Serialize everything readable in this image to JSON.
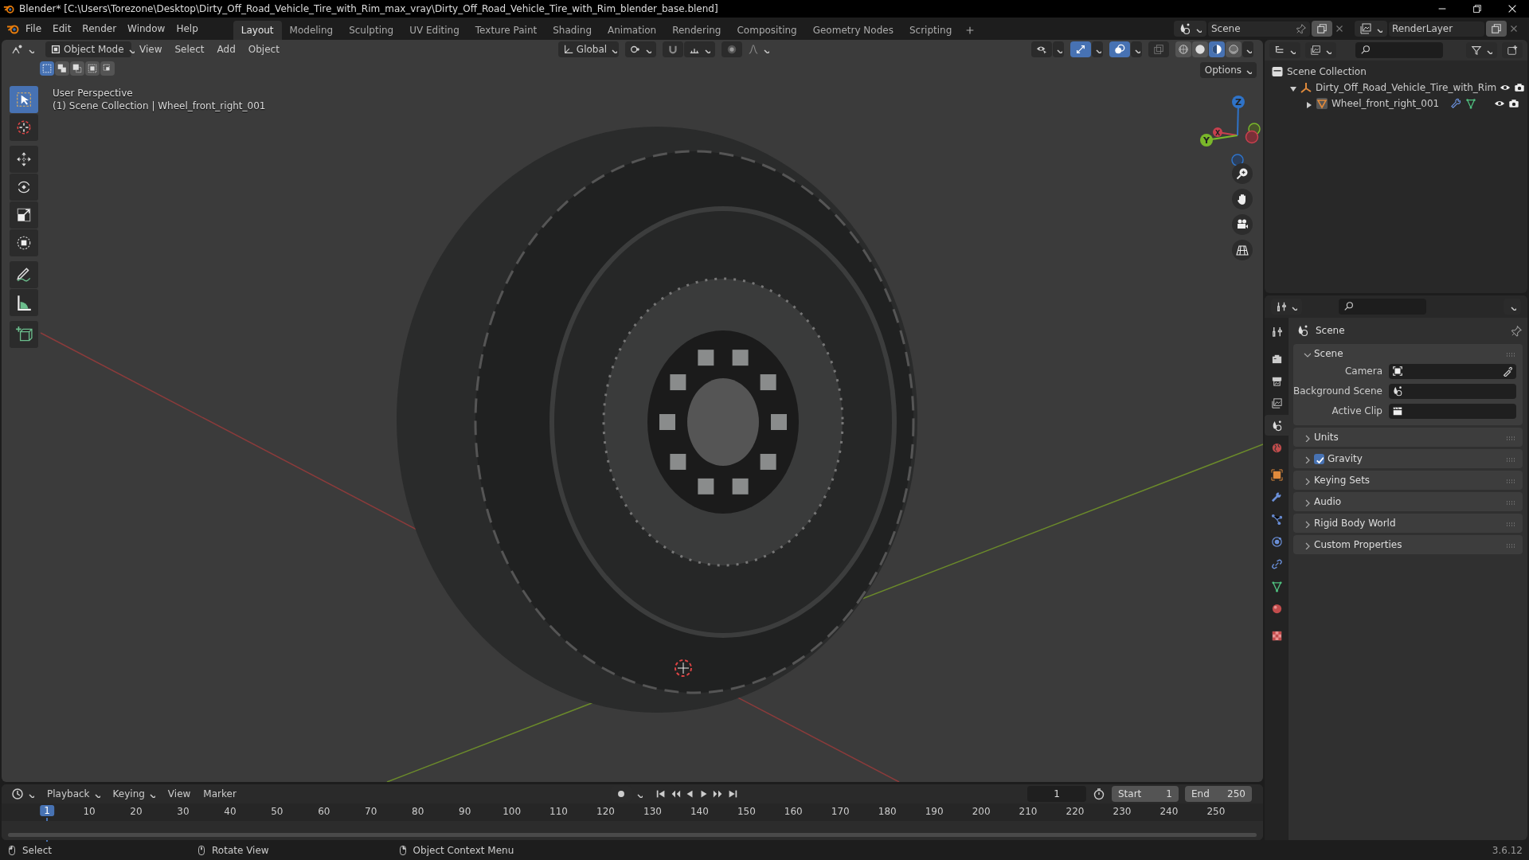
{
  "window": {
    "title": "Blender* [C:\\Users\\Torezone\\Desktop\\Dirty_Off_Road_Vehicle_Tire_with_Rim_max_vray\\Dirty_Off_Road_Vehicle_Tire_with_Rim_blender_base.blend]"
  },
  "menu": [
    "File",
    "Edit",
    "Render",
    "Window",
    "Help"
  ],
  "workspaces": [
    {
      "label": "Layout",
      "selected": true
    },
    {
      "label": "Modeling",
      "selected": false
    },
    {
      "label": "Sculpting",
      "selected": false
    },
    {
      "label": "UV Editing",
      "selected": false
    },
    {
      "label": "Texture Paint",
      "selected": false
    },
    {
      "label": "Shading",
      "selected": false
    },
    {
      "label": "Animation",
      "selected": false
    },
    {
      "label": "Rendering",
      "selected": false
    },
    {
      "label": "Compositing",
      "selected": false
    },
    {
      "label": "Geometry Nodes",
      "selected": false
    },
    {
      "label": "Scripting",
      "selected": false
    }
  ],
  "scene": "Scene",
  "view_layer": "RenderLayer",
  "viewport": {
    "mode": "Object Mode",
    "menus": [
      "View",
      "Select",
      "Add",
      "Object"
    ],
    "orientation": "Global",
    "toggles": [
      {
        "kind": "visibility",
        "on": false
      },
      {
        "kind": "gizmo",
        "on": true
      },
      {
        "kind": "overlay",
        "on": true
      },
      {
        "kind": "xray",
        "on": false
      }
    ],
    "shading": [
      {
        "kind": "wireframe",
        "selected": false
      },
      {
        "kind": "solid",
        "selected": false
      },
      {
        "kind": "material",
        "selected": true
      },
      {
        "kind": "rendered",
        "selected": false
      }
    ],
    "select_modes": [
      {
        "kind": "new",
        "selected": true
      },
      {
        "kind": "extend",
        "selected": false
      },
      {
        "kind": "subtract",
        "selected": false
      },
      {
        "kind": "invert",
        "selected": false
      },
      {
        "kind": "intersect",
        "selected": false
      }
    ],
    "options": "Options",
    "info": [
      "User Perspective",
      "(1) Scene Collection | Wheel_front_right_001"
    ],
    "tools": [
      {
        "kind": "select",
        "selected": true
      },
      {
        "kind": "cursor",
        "selected": false
      },
      {
        "kind": "move",
        "selected": false
      },
      {
        "kind": "rotate",
        "selected": false
      },
      {
        "kind": "scale",
        "selected": false
      },
      {
        "kind": "transform",
        "selected": false
      },
      {
        "kind": "annotate",
        "selected": false
      },
      {
        "kind": "measure",
        "selected": false
      },
      {
        "kind": "add_cube",
        "selected": false
      }
    ],
    "gizmo": [
      "Z",
      "Y",
      "X"
    ]
  },
  "outliner": {
    "tree": [
      {
        "label": "Scene Collection",
        "kind": "collection",
        "children": [
          {
            "label": "Dirty_Off_Road_Vehicle_Tire_with_Rim",
            "kind": "empty",
            "expanded": true,
            "children": [
              {
                "label": "Wheel_front_right_001",
                "kind": "mesh",
                "expanded": false
              }
            ]
          }
        ]
      }
    ]
  },
  "properties": {
    "tabs": [
      {
        "kind": "tool",
        "selected": false
      },
      {
        "kind": "render",
        "selected": false
      },
      {
        "kind": "output",
        "selected": false
      },
      {
        "kind": "view_layer",
        "selected": false
      },
      {
        "kind": "scene",
        "selected": true
      },
      {
        "kind": "world",
        "selected": false
      },
      {
        "kind": "object",
        "selected": false
      },
      {
        "kind": "modifiers",
        "selected": false
      },
      {
        "kind": "particles",
        "selected": false
      },
      {
        "kind": "physics",
        "selected": false
      },
      {
        "kind": "constraints",
        "selected": false
      },
      {
        "kind": "data",
        "selected": false
      },
      {
        "kind": "material",
        "selected": false
      },
      {
        "kind": "texture",
        "selected": false
      }
    ],
    "context": "Scene",
    "panels": [
      {
        "label": "Scene",
        "kind": "plain",
        "expanded": true,
        "fields": [
          {
            "label": "Camera",
            "kind": "camera"
          },
          {
            "label": "Background Scene",
            "kind": "scene"
          },
          {
            "label": "Active Clip",
            "kind": "clip"
          }
        ]
      },
      {
        "label": "Units",
        "kind": "plain",
        "expanded": false
      },
      {
        "label": "Gravity",
        "kind": "checkbox",
        "checked": true,
        "expanded": false
      },
      {
        "label": "Keying Sets",
        "kind": "plain",
        "expanded": false
      },
      {
        "label": "Audio",
        "kind": "plain",
        "expanded": false
      },
      {
        "label": "Rigid Body World",
        "kind": "plain",
        "expanded": false
      },
      {
        "label": "Custom Properties",
        "kind": "plain",
        "expanded": false
      }
    ]
  },
  "timeline": {
    "menus": [
      "Playback",
      "Keying",
      "View",
      "Marker"
    ],
    "frame": "1",
    "start_label": "Start",
    "start": "1",
    "end_label": "End",
    "end": "250",
    "playhead": "1",
    "ticks": [
      "10",
      "20",
      "30",
      "40",
      "50",
      "60",
      "70",
      "80",
      "90",
      "100",
      "110",
      "120",
      "130",
      "140",
      "150",
      "160",
      "170",
      "180",
      "190",
      "200",
      "210",
      "220",
      "230",
      "240",
      "250"
    ]
  },
  "status_bar": {
    "items": [
      {
        "kind": "left",
        "label": "Select"
      },
      {
        "kind": "middle",
        "label": "Rotate View"
      },
      {
        "kind": "right",
        "label": "Object Context Menu"
      }
    ],
    "version": "3.6.12"
  }
}
